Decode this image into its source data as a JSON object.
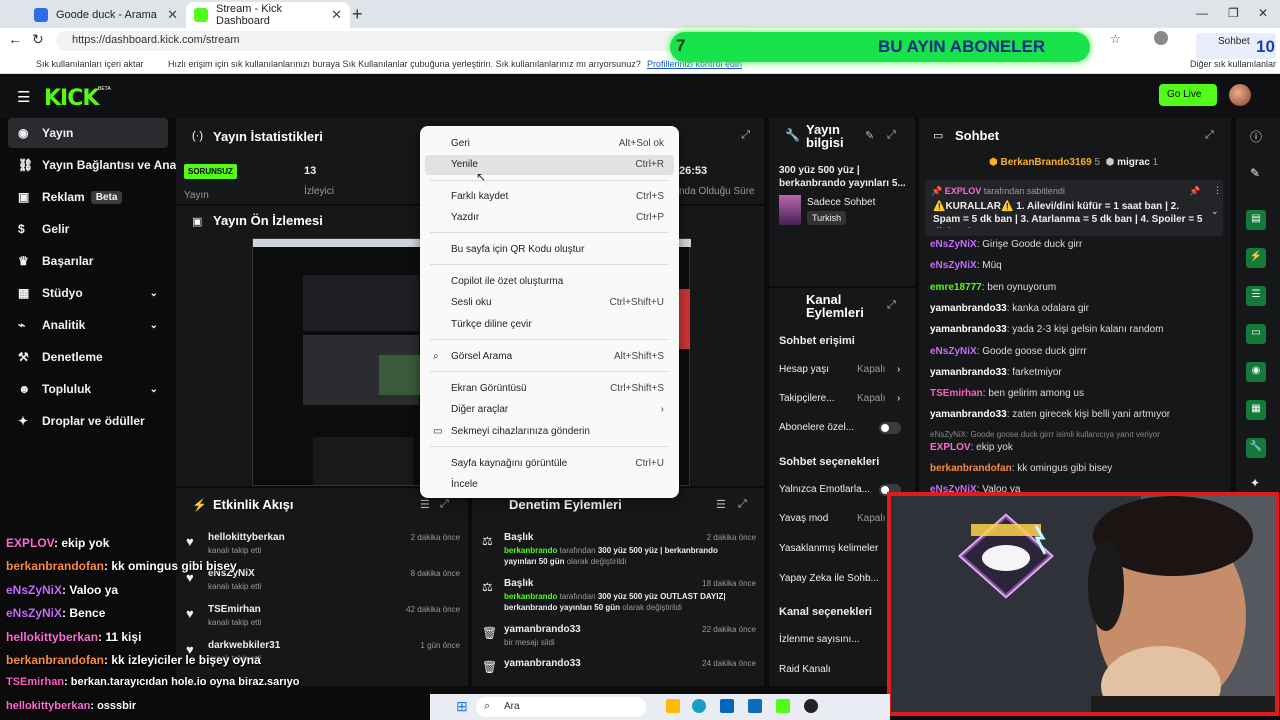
{
  "browser": {
    "tabs": [
      {
        "title": "Goode duck - Arama"
      },
      {
        "title": "Stream - Kick Dashboard"
      }
    ],
    "url": "https://dashboard.kick.com/stream",
    "bookmarks": {
      "item1": "Sık kullanılanları içeri aktar",
      "hint": "Hızlı erişim için sık kullanılanlarınızı buraya Sık Kullanılanlar çubuğuna yerleştirin. Sık kullanılanlarınız mı arıyorsunuz?",
      "manage_link": "Profillerinizi kontrol edin",
      "other": "Diğer sık kullanılanlar"
    }
  },
  "overlay_banner": {
    "left_num": "7",
    "title": "BU AYIN ABONELER",
    "right_num": "10",
    "right_label": "Sohbet"
  },
  "kick": {
    "logo": "KICK",
    "beta_tag": "BETA",
    "go_live": "Go Live"
  },
  "sidebar": {
    "items": [
      {
        "label": "Yayın"
      },
      {
        "label": "Yayın Bağlantısı ve Anahtar"
      },
      {
        "label": "Reklam",
        "badge": "Beta"
      },
      {
        "label": "Gelir"
      },
      {
        "label": "Başarılar"
      },
      {
        "label": "Stüdyo"
      },
      {
        "label": "Analitik"
      },
      {
        "label": "Denetleme"
      },
      {
        "label": "Topluluk"
      },
      {
        "label": "Droplar ve ödüller"
      }
    ]
  },
  "stats": {
    "title": "Yayın İstatistikleri",
    "status_badge": "SORUNSUZ",
    "status_label": "Yayın",
    "viewers_value": "13",
    "viewers_label": "İzleyici",
    "time_value": "26:53",
    "time_label": "nda Olduğu Süre"
  },
  "preview": {
    "title": "Yayın Ön İzlemesi"
  },
  "stream_info": {
    "title": "Yayın bilgisi",
    "stream_title": "300 yüz 500 yüz | berkanbrando yayınları 5...",
    "category": "Sadece Sohbet",
    "language": "Turkish"
  },
  "channel_actions": {
    "title": "Kanal Eylemleri",
    "chat_access": "Sohbet erişimi",
    "rows1": [
      {
        "label": "Hesap yaşı",
        "value": "Kapalı"
      },
      {
        "label": "Takipçilere...",
        "value": "Kapalı"
      },
      {
        "label": "Abonelere özel..."
      }
    ],
    "chat_options": "Sohbet seçenekleri",
    "rows2": [
      {
        "label": "Yalnızca Emotlarla..."
      },
      {
        "label": "Yavaş mod",
        "value": "Kapalı"
      },
      {
        "label": "Yasaklanmış kelimeler"
      },
      {
        "label": "Yapay Zeka ile Sohb..."
      }
    ],
    "channel_options": "Kanal seçenekleri",
    "rows3": [
      {
        "label": "İzlenme sayısını..."
      },
      {
        "label": "Raid Kanalı"
      }
    ]
  },
  "chat": {
    "title": "Sohbet",
    "top_gifters": [
      {
        "name": "BerkanBrando3169",
        "count": "5"
      },
      {
        "name": "migrac",
        "count": "1"
      }
    ],
    "pinned_by": "EXPLOV",
    "pinned_suffix": "tarafından sabitlendi",
    "pinned_text": "⚠️KURALLAR⚠️ 1. Ailevi/dini küfür = 1 saat ban | 2. Spam = 5 dk ban | 3. Atarlanma = 5 dk ban | 4. Spoiler = 5 dk ban |...",
    "messages": [
      {
        "user": "eNsZyNiX",
        "text": "Girişe Goode duck girr",
        "color": "#c86bff"
      },
      {
        "user": "eNsZyNiX",
        "text": "Müq",
        "color": "#c86bff"
      },
      {
        "user": "emre18777",
        "text": "ben oynuyorum",
        "color": "#53fc18"
      },
      {
        "user": "yamanbrando33",
        "text": "kanka odalara gir",
        "color": "#ffffff"
      },
      {
        "user": "yamanbrando33",
        "text": "yada 2-3 kişi gelsin kalanı random",
        "color": "#ffffff"
      },
      {
        "user": "eNsZyNiX",
        "text": "Goode goose duck girrr",
        "color": "#c86bff"
      },
      {
        "user": "yamanbrando33",
        "text": "farketmiyor",
        "color": "#ffffff"
      },
      {
        "user": "TSEmirhan",
        "text": "ben gelirim among us",
        "color": "#ff5ec4"
      },
      {
        "user": "yamanbrando33",
        "text": "zaten girecek kişi belli yani artmıyor",
        "color": "#ffffff"
      }
    ],
    "reply_note": "eNsZyNiX: Goode goose duck girrr isimli kullanıcıya yanıt veriyor",
    "msg_reply": {
      "user": "EXPLOV",
      "text": "ekip yok",
      "color": "#ff6ad5"
    },
    "msg_last1": {
      "user": "berkanbrandofan",
      "text": "kk omingus gibi bisey",
      "color": "#ff8a3d"
    },
    "msg_last2": {
      "user": "eNsZyNiX",
      "text": "Valoo ya",
      "color": "#c86bff"
    }
  },
  "activity": {
    "title": "Etkinlik Akışı",
    "items": [
      {
        "user": "hellokittyberkan",
        "action": "kanalı takip etti",
        "time": "2 dakika önce"
      },
      {
        "user": "eNsZyNiX",
        "action": "kanalı takip etti",
        "time": "8 dakika önce"
      },
      {
        "user": "TSEmirhan",
        "action": "kanalı takip etti",
        "time": "42 dakika önce"
      },
      {
        "user": "darkwebkiler31",
        "action": "kanalı takip etti",
        "time": "1 gün önce"
      }
    ]
  },
  "moderation": {
    "title": "Denetim Eylemleri",
    "items": [
      {
        "head": "Başlık",
        "time": "2 dakika önce",
        "by": "berkanbrando",
        "mid": "tarafından",
        "detail": "300 yüz 500 yüz | berkanbrando",
        "detail2": "yayınları 50 gün",
        "tail": "olarak değiştirildi"
      },
      {
        "head": "Başlık",
        "time": "18 dakika önce",
        "by": "berkanbrando",
        "mid": "tarafından",
        "detail": "300 yüz 500 yüz OUTLAST DAYIZ|",
        "detail2": "berkanbrando yayınları 50 gün",
        "tail": "olarak değiştirildi"
      },
      {
        "head": "yamanbrando33",
        "time": "22 dakika önce",
        "sub": "bir mesajı sildi"
      },
      {
        "head": "yamanbrando33",
        "time": "24 dakika önce",
        "sub": ""
      }
    ]
  },
  "context_menu": {
    "items": [
      {
        "label": "Geri",
        "shortcut": "Alt+Sol ok"
      },
      {
        "label": "Yenile",
        "shortcut": "Ctrl+R"
      },
      {
        "label": "Farklı kaydet",
        "shortcut": "Ctrl+S"
      },
      {
        "label": "Yazdır",
        "shortcut": "Ctrl+P"
      },
      {
        "label": "Bu sayfa için QR Kodu oluştur",
        "shortcut": ""
      },
      {
        "label": "Copilot ile özet oluşturma",
        "shortcut": ""
      },
      {
        "label": "Sesli oku",
        "shortcut": "Ctrl+Shift+U"
      },
      {
        "label": "Türkçe diline çevir",
        "shortcut": ""
      },
      {
        "label": "Görsel Arama",
        "shortcut": "Alt+Shift+S"
      },
      {
        "label": "Ekran Görüntüsü",
        "shortcut": "Ctrl+Shift+S"
      },
      {
        "label": "Diğer araçlar",
        "shortcut": "›"
      },
      {
        "label": "Sekmeyi cihazlarınıza gönderin",
        "shortcut": ""
      },
      {
        "label": "Sayfa kaynağını görüntüle",
        "shortcut": "Ctrl+U"
      },
      {
        "label": "İncele",
        "shortcut": ""
      }
    ]
  },
  "stream_overlay_chat": [
    {
      "user": "EXPLOV",
      "text": ": ekip yok",
      "color": "#ff6ad5"
    },
    {
      "user": "berkanbrandofan",
      "text": ": kk omingus gibi bisey",
      "color": "#ff8a3d"
    },
    {
      "user": "eNsZyNiX",
      "text": ": Valoo ya",
      "color": "#c86bff"
    },
    {
      "user": "eNsZyNiX",
      "text": ": Bence",
      "color": "#c86bff"
    },
    {
      "user": "hellokittyberkan",
      "text": ": 11 kişi",
      "color": "#ff6ad5"
    },
    {
      "user": "berkanbrandofan",
      "text": ": kk izleyiciler le bişey oyna",
      "color": "#ff8a3d"
    },
    {
      "user": "TSEmirhan",
      "text": ": berkan.tarayıcıdan hole.io oyna biraz.sarıyo",
      "color": "#ff5ec4"
    },
    {
      "user": "hellokittyberkan",
      "text": ": osssbir",
      "color": "#ff6ad5"
    }
  ],
  "taskbar": {
    "search": "Ara"
  },
  "colors": {
    "accent": "#53fc18",
    "background": "#0b0b0c",
    "panel": "#161719",
    "banner": "#19e34a",
    "webcam_border": "#e01b1b"
  }
}
